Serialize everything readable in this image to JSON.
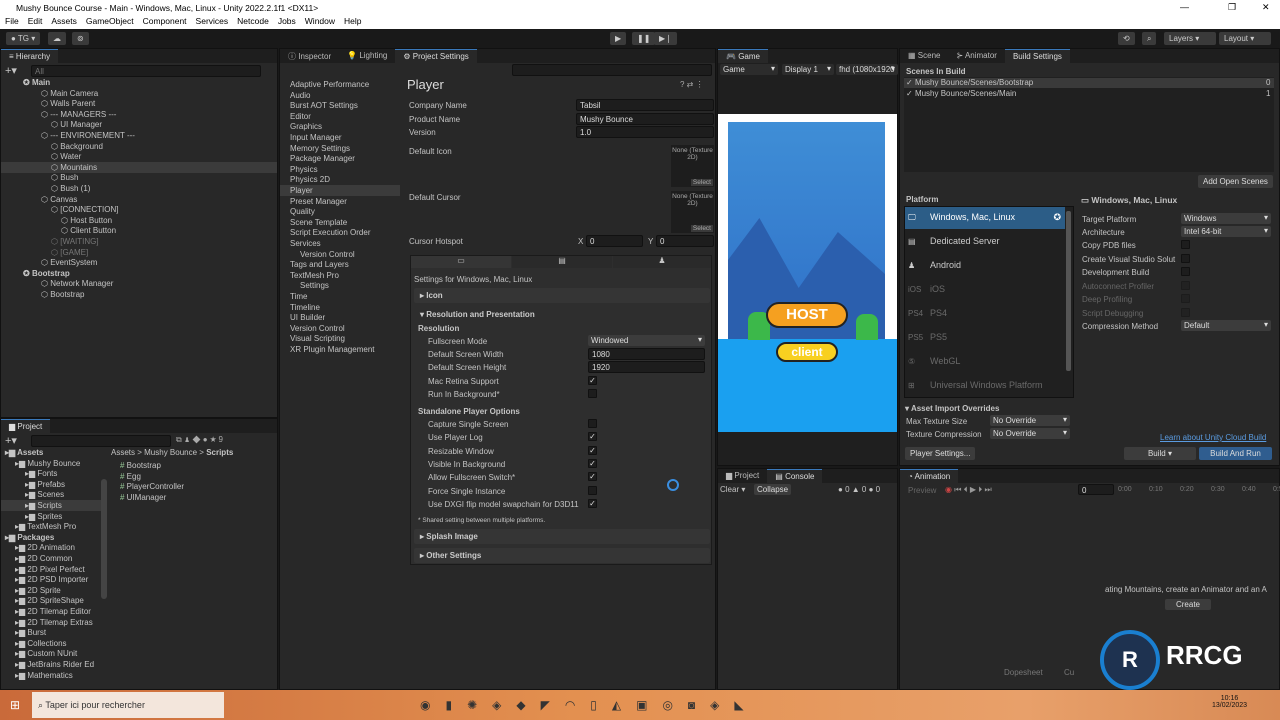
{
  "window": {
    "title": "Mushy Bounce Course - Main - Windows, Mac, Linux - Unity 2022.2.1f1 <DX11>"
  },
  "menu": [
    "File",
    "Edit",
    "Assets",
    "GameObject",
    "Component",
    "Services",
    "Netcode",
    "Jobs",
    "Window",
    "Help"
  ],
  "toolbar": {
    "account": "TG",
    "layers": "Layers",
    "layout": "Layout"
  },
  "hierarchy": {
    "tab": "Hierarchy",
    "search_placeholder": "All",
    "items": [
      {
        "label": "Main",
        "depth": 0,
        "bold": true
      },
      {
        "label": "Main Camera",
        "depth": 1
      },
      {
        "label": "Walls Parent",
        "depth": 1
      },
      {
        "label": "--- MANAGERS ---",
        "depth": 1
      },
      {
        "label": "UI Manager",
        "depth": 2
      },
      {
        "label": "--- ENVIRONEMENT ---",
        "depth": 1
      },
      {
        "label": "Background",
        "depth": 2
      },
      {
        "label": "Water",
        "depth": 2
      },
      {
        "label": "Mountains",
        "depth": 2,
        "selected": true
      },
      {
        "label": "Bush",
        "depth": 2
      },
      {
        "label": "Bush (1)",
        "depth": 2
      },
      {
        "label": "Canvas",
        "depth": 1
      },
      {
        "label": "[CONNECTION]",
        "depth": 2
      },
      {
        "label": "Host Button",
        "depth": 3
      },
      {
        "label": "Client Button",
        "depth": 3
      },
      {
        "label": "[WAITING]",
        "depth": 2,
        "dim": true
      },
      {
        "label": "[GAME]",
        "depth": 2,
        "dim": true
      },
      {
        "label": "EventSystem",
        "depth": 1
      },
      {
        "label": "Bootstrap",
        "depth": 0,
        "bold": true
      },
      {
        "label": "Network Manager",
        "depth": 1
      },
      {
        "label": "Bootstrap",
        "depth": 1
      }
    ]
  },
  "project": {
    "tab": "Project",
    "hidden_count": "9",
    "breadcrumb": [
      "Assets",
      "Mushy Bounce",
      "Scripts"
    ],
    "tree": [
      {
        "label": "Assets",
        "depth": 0,
        "bold": true
      },
      {
        "label": "Mushy Bounce",
        "depth": 1
      },
      {
        "label": "Fonts",
        "depth": 2
      },
      {
        "label": "Prefabs",
        "depth": 2
      },
      {
        "label": "Scenes",
        "depth": 2
      },
      {
        "label": "Scripts",
        "depth": 2,
        "selected": true
      },
      {
        "label": "Sprites",
        "depth": 2
      },
      {
        "label": "TextMesh Pro",
        "depth": 1
      },
      {
        "label": "Packages",
        "depth": 0,
        "bold": true
      },
      {
        "label": "2D Animation",
        "depth": 1
      },
      {
        "label": "2D Common",
        "depth": 1
      },
      {
        "label": "2D Pixel Perfect",
        "depth": 1
      },
      {
        "label": "2D PSD Importer",
        "depth": 1
      },
      {
        "label": "2D Sprite",
        "depth": 1
      },
      {
        "label": "2D SpriteShape",
        "depth": 1
      },
      {
        "label": "2D Tilemap Editor",
        "depth": 1
      },
      {
        "label": "2D Tilemap Extras",
        "depth": 1
      },
      {
        "label": "Burst",
        "depth": 1
      },
      {
        "label": "Collections",
        "depth": 1
      },
      {
        "label": "Custom NUnit",
        "depth": 1
      },
      {
        "label": "JetBrains Rider Ed",
        "depth": 1
      },
      {
        "label": "Mathematics",
        "depth": 1
      }
    ],
    "files": [
      "Bootstrap",
      "Egg",
      "PlayerController",
      "UIManager"
    ]
  },
  "inspector": {
    "tabs": [
      "Inspector",
      "Lighting",
      "Project Settings"
    ],
    "categories": [
      "Adaptive Performance",
      "Audio",
      "Burst AOT Settings",
      "Editor",
      "Graphics",
      "Input Manager",
      "Memory Settings",
      "Package Manager",
      "Physics",
      "Physics 2D",
      "Player",
      "Preset Manager",
      "Quality",
      "Scene Template",
      "Script Execution Order",
      "Services",
      "Version Control",
      "Tags and Layers",
      "TextMesh Pro",
      "Settings",
      "Time",
      "Timeline",
      "UI Builder",
      "Version Control",
      "Visual Scripting",
      "XR Plugin Management"
    ],
    "title": "Player",
    "company_label": "Company Name",
    "company": "Tabsil",
    "product_label": "Product Name",
    "product": "Mushy Bounce",
    "version_label": "Version",
    "version": "1.0",
    "icon_label": "Default Icon",
    "cursor_label": "Default Cursor",
    "none_texture": "None (Texture 2D)",
    "select": "Select",
    "hotspot_label": "Cursor Hotspot",
    "hx_label": "X",
    "hx": "0",
    "hy_label": "Y",
    "hy": "0",
    "settings_for": "Settings for Windows, Mac, Linux",
    "sec_icon": "Icon",
    "sec_res": "Resolution and Presentation",
    "res_sub": "Resolution",
    "fullscreen_label": "Fullscreen Mode",
    "fullscreen": "Windowed",
    "width_label": "Default Screen Width",
    "width": "1080",
    "height_label": "Default Screen Height",
    "height": "1920",
    "retina_label": "Mac Retina Support",
    "retina": true,
    "runbg_label": "Run In Background*",
    "runbg": false,
    "standalone": "Standalone Player Options",
    "options": [
      {
        "label": "Capture Single Screen",
        "on": false
      },
      {
        "label": "Use Player Log",
        "on": true
      },
      {
        "label": "Resizable Window",
        "on": true
      },
      {
        "label": "Visible In Background",
        "on": true
      },
      {
        "label": "Allow Fullscreen Switch*",
        "on": true
      },
      {
        "label": "Force Single Instance",
        "on": false
      },
      {
        "label": "Use DXGI flip model swapchain for D3D11",
        "on": true
      }
    ],
    "note": "* Shared setting between multiple platforms.",
    "sec_splash": "Splash Image",
    "sec_other": "Other Settings"
  },
  "game": {
    "tab": "Game",
    "mode": "Game",
    "display": "Display 1",
    "resolution": "fhd (1080x1920",
    "host": "HOST",
    "client": "client"
  },
  "build": {
    "tabs": [
      "Scene",
      "Animator",
      "Build Settings"
    ],
    "scenes_title": "Scenes In Build",
    "scenes": [
      {
        "path": "Mushy Bounce/Scenes/Bootstrap",
        "index": "0"
      },
      {
        "path": "Mushy Bounce/Scenes/Main",
        "index": "1"
      }
    ],
    "add_open": "Add Open Scenes",
    "platform_title": "Platform",
    "platforms": [
      "Windows, Mac, Linux",
      "Dedicated Server",
      "Android",
      "iOS",
      "PS4",
      "PS5",
      "WebGL",
      "Universal Windows Platform"
    ],
    "platform_icons": [
      "monitor-icon",
      "server-icon",
      "android-icon",
      "ios-icon",
      "ps4-icon",
      "ps5-icon",
      "html5-icon",
      "windows-icon"
    ],
    "selected_title": "Windows, Mac, Linux",
    "target_label": "Target Platform",
    "target": "Windows",
    "arch_label": "Architecture",
    "arch": "Intel 64-bit",
    "checks": [
      {
        "label": "Copy PDB files",
        "dim": false
      },
      {
        "label": "Create Visual Studio Solut",
        "dim": false
      },
      {
        "label": "Development Build",
        "dim": false
      },
      {
        "label": "Autoconnect Profiler",
        "dim": true
      },
      {
        "label": "Deep Profiling",
        "dim": true
      },
      {
        "label": "Script Debugging",
        "dim": true
      }
    ],
    "compression_label": "Compression Method",
    "compression": "Default",
    "overrides_title": "Asset Import Overrides",
    "maxtex_label": "Max Texture Size",
    "maxtex": "No Override",
    "texcomp_label": "Texture Compression",
    "texcomp": "No Override",
    "cloud_link": "Learn about Unity Cloud Build",
    "player_settings": "Player Settings...",
    "build": "Build",
    "build_run": "Build And Run"
  },
  "console": {
    "tabs": [
      "Project",
      "Console"
    ],
    "clear": "Clear",
    "collapse": "Collapse",
    "logs": "0",
    "warnings": "0",
    "errors": "0"
  },
  "animation": {
    "tab": "Animation",
    "preview": "Preview",
    "frame": "0",
    "ticks": [
      "0:00",
      "0:10",
      "0:20",
      "0:30",
      "0:40",
      "0:50"
    ],
    "hint": "ating Mountains, create an Animator and an A",
    "create": "Create",
    "dopesheet": "Dopesheet",
    "curves": "Cu"
  },
  "taskbar": {
    "search_placeholder": "Taper ici pour rechercher",
    "time": "10:16",
    "date": "13/02/2023"
  },
  "watermark": "RRCG 人人素材"
}
